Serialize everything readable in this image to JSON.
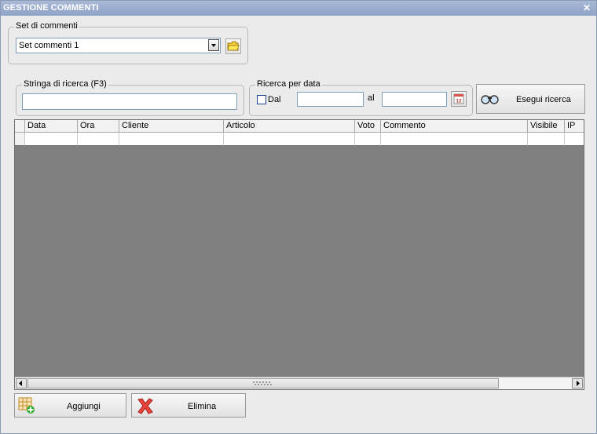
{
  "window": {
    "title": "GESTIONE COMMENTI",
    "close_glyph": "✕"
  },
  "set_commenti": {
    "legend": "Set di commenti",
    "selected": "Set commenti 1"
  },
  "search": {
    "legend": "Stringa di ricerca (F3)",
    "value": ""
  },
  "date_search": {
    "legend": "Ricerca per data",
    "from_label": "Dal",
    "from_value": "",
    "to_label": "al",
    "to_value": "",
    "from_checked": false
  },
  "run_search_label": "Esegui ricerca",
  "table": {
    "columns": [
      "Data",
      "Ora",
      "Cliente",
      "Articolo",
      "Voto",
      "Commento",
      "Visibile",
      "IP"
    ],
    "rows": []
  },
  "actions": {
    "add_label": "Aggiungi",
    "delete_label": "Elimina"
  },
  "icons": {
    "folder": "folder-icon",
    "calendar": "calendar-icon",
    "binoculars": "binoculars-icon",
    "add_row": "add-row-icon",
    "delete": "delete-icon"
  },
  "colors": {
    "titlebar": "#97a9cb",
    "panel": "#ebebeb",
    "grid_empty": "#808080",
    "delete_red": "#e8463c",
    "add_green": "#2fae2f"
  }
}
